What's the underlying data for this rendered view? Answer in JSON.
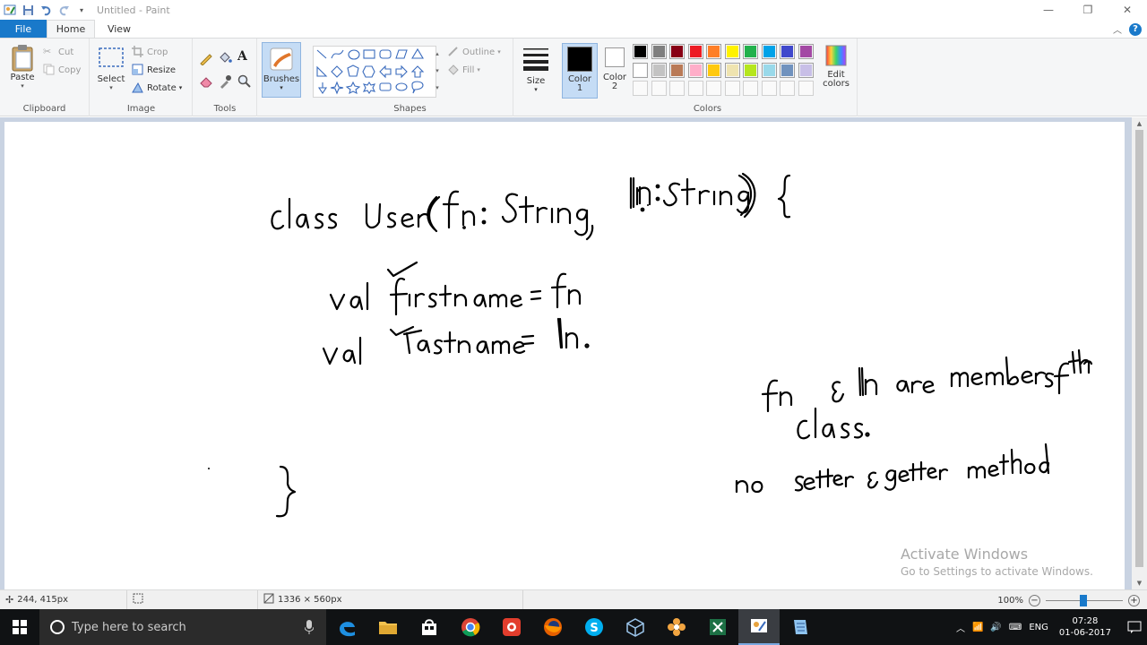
{
  "window": {
    "title": "Untitled - Paint",
    "controls": [
      "minimize-icon",
      "restore-icon",
      "close-icon"
    ]
  },
  "tabs": {
    "file": "File",
    "home": "Home",
    "view": "View"
  },
  "ribbon": {
    "clipboard": {
      "label": "Clipboard",
      "paste": "Paste",
      "cut": "Cut",
      "copy": "Copy"
    },
    "image": {
      "label": "Image",
      "select": "Select",
      "crop": "Crop",
      "resize": "Resize",
      "rotate": "Rotate"
    },
    "tools": {
      "label": "Tools"
    },
    "brushes": {
      "label": "Brushes"
    },
    "shapes": {
      "label": "Shapes",
      "outline": "Outline",
      "fill": "Fill"
    },
    "size": {
      "label": "Size"
    },
    "colors": {
      "label": "Colors",
      "color1": "Color\n1",
      "color1_a": "Color",
      "color1_b": "1",
      "color2_a": "Color",
      "color2_b": "2",
      "edit_a": "Edit",
      "edit_b": "colors",
      "color1_value": "#000000",
      "color2_value": "#ffffff",
      "palette_row1": [
        "#000000",
        "#7f7f7f",
        "#880015",
        "#ed1c24",
        "#ff7f27",
        "#fff200",
        "#22b14c",
        "#00a2e8",
        "#3f48cc",
        "#a349a4"
      ],
      "palette_row2": [
        "#ffffff",
        "#c3c3c3",
        "#b97a57",
        "#ffaec9",
        "#ffc90e",
        "#efe4b0",
        "#b5e61d",
        "#99d9ea",
        "#7092be",
        "#c8bfe7"
      ]
    }
  },
  "canvas": {
    "handwriting": [
      "class User (fn: String, ln: String) {",
      "val firstname = fn",
      "val lastname = ln.",
      "}",
      "fn & ln are members of the",
      "class.",
      "no setter & getter method"
    ]
  },
  "watermark": {
    "title": "Activate Windows",
    "subtitle": "Go to Settings to activate Windows."
  },
  "status": {
    "cursor": "244, 415px",
    "selection": "",
    "canvas_size": "1336 × 560px",
    "zoom": "100%"
  },
  "taskbar": {
    "search_placeholder": "Type here to search",
    "lang": "ENG",
    "time": "07:28",
    "date": "01-06-2017"
  }
}
